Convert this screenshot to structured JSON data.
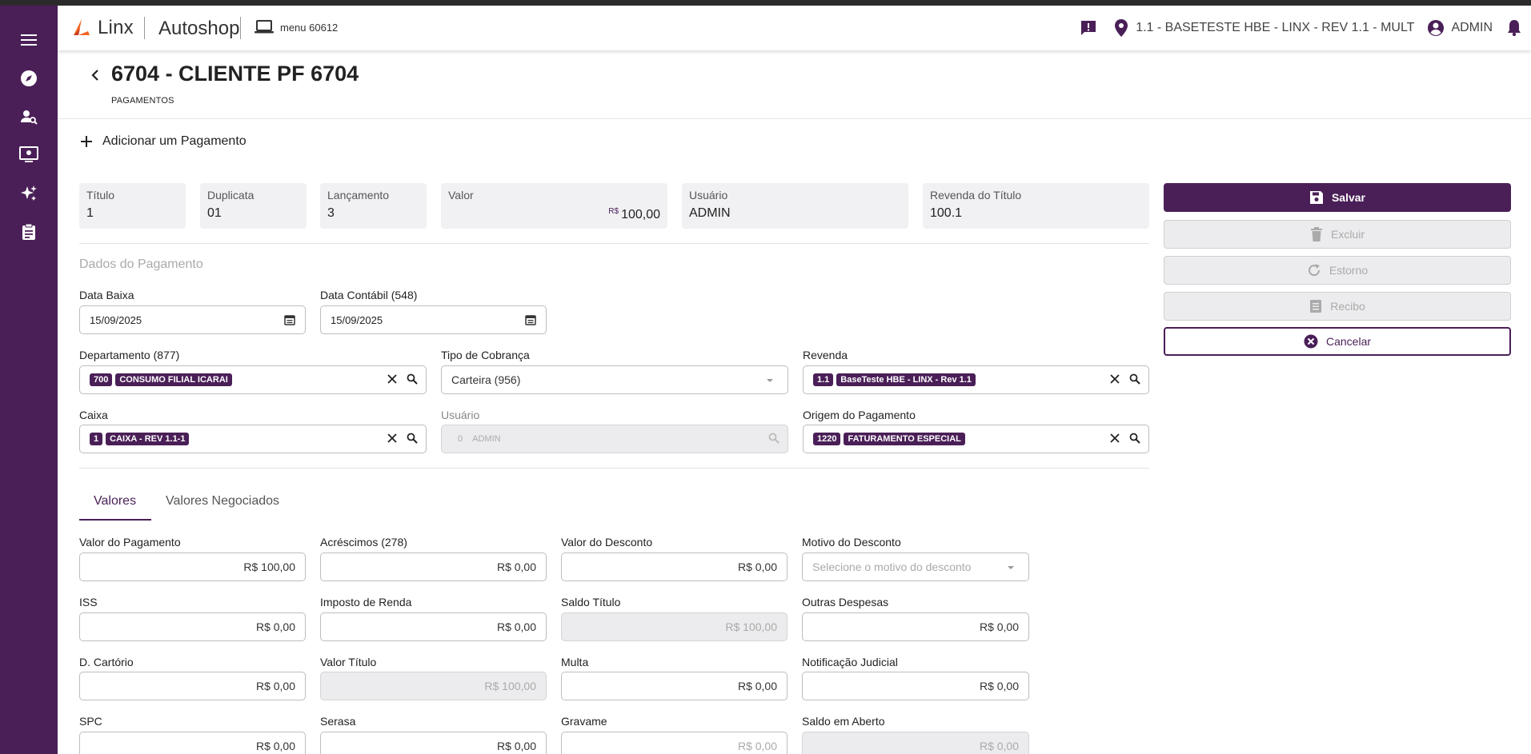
{
  "header": {
    "brand": "Linx",
    "app": "Autoshop",
    "menu": "menu 60612",
    "location": "1.1 - BASETESTE HBE - LINX - REV 1.1 - MULT",
    "user": "ADMIN"
  },
  "page": {
    "title": "6704 - CLIENTE PF 6704",
    "subtitle": "PAGAMENTOS",
    "add_payment": "Adicionar um Pagamento",
    "section_title": "Dados do Pagamento"
  },
  "summary": {
    "titulo": {
      "label": "Título",
      "value": "1"
    },
    "duplicata": {
      "label": "Duplicata",
      "value": "01"
    },
    "lancamento": {
      "label": "Lançamento",
      "value": "3"
    },
    "valor": {
      "label": "Valor",
      "currency": "R$",
      "value": "100,00"
    },
    "usuario": {
      "label": "Usuário",
      "value": "ADMIN"
    },
    "revenda": {
      "label": "Revenda do Título",
      "value": "100.1"
    }
  },
  "form": {
    "data_baixa": {
      "label": "Data Baixa",
      "value": "15/09/2025"
    },
    "data_contabil": {
      "label": "Data Contábil (548)",
      "value": "15/09/2025"
    },
    "departamento": {
      "label": "Departamento (877)",
      "code": "700",
      "name": "CONSUMO FILIAL ICARAI"
    },
    "tipo_cobranca": {
      "label": "Tipo de Cobrança",
      "value": "Carteira (956)"
    },
    "revenda": {
      "label": "Revenda",
      "code": "1.1",
      "name": "BaseTeste HBE - LINX - Rev 1.1"
    },
    "caixa": {
      "label": "Caixa",
      "code": "1",
      "name": "CAIXA - REV 1.1-1"
    },
    "usuario": {
      "label": "Usuário",
      "code": "0",
      "name": "ADMIN"
    },
    "origem": {
      "label": "Origem do Pagamento",
      "code": "1220",
      "name": "FATURAMENTO ESPECIAL"
    }
  },
  "tabs": {
    "valores": "Valores",
    "negociados": "Valores Negociados"
  },
  "valores": {
    "valor_pagamento": {
      "label": "Valor do Pagamento",
      "value": "R$ 100,00"
    },
    "acrescimos": {
      "label": "Acréscimos (278)",
      "value": "R$ 0,00"
    },
    "valor_desconto": {
      "label": "Valor do Desconto",
      "value": "R$ 0,00"
    },
    "motivo_desconto": {
      "label": "Motivo do Desconto",
      "placeholder": "Selecione o motivo do desconto"
    },
    "iss": {
      "label": "ISS",
      "value": "R$ 0,00"
    },
    "imposto_renda": {
      "label": "Imposto de Renda",
      "value": "R$ 0,00"
    },
    "saldo_titulo": {
      "label": "Saldo Título",
      "value": "R$ 100,00"
    },
    "outras_despesas": {
      "label": "Outras Despesas",
      "value": "R$ 0,00"
    },
    "d_cartorio": {
      "label": "D. Cartório",
      "value": "R$ 0,00"
    },
    "valor_titulo": {
      "label": "Valor Título",
      "value": "R$ 100,00"
    },
    "multa": {
      "label": "Multa",
      "value": "R$ 0,00"
    },
    "notificacao": {
      "label": "Notificação Judicial",
      "value": "R$ 0,00"
    },
    "spc": {
      "label": "SPC",
      "value": "R$ 0,00"
    },
    "serasa": {
      "label": "Serasa",
      "value": "R$ 0,00"
    },
    "gravame": {
      "label": "Gravame",
      "value": "R$ 0,00"
    },
    "saldo_aberto": {
      "label": "Saldo em Aberto",
      "value": "R$ 0,00"
    }
  },
  "actions": {
    "salvar": "Salvar",
    "excluir": "Excluir",
    "estorno": "Estorno",
    "recibo": "Recibo",
    "cancelar": "Cancelar"
  },
  "colors": {
    "brand": "#4a1f57",
    "accent_logo": "#f26522"
  }
}
